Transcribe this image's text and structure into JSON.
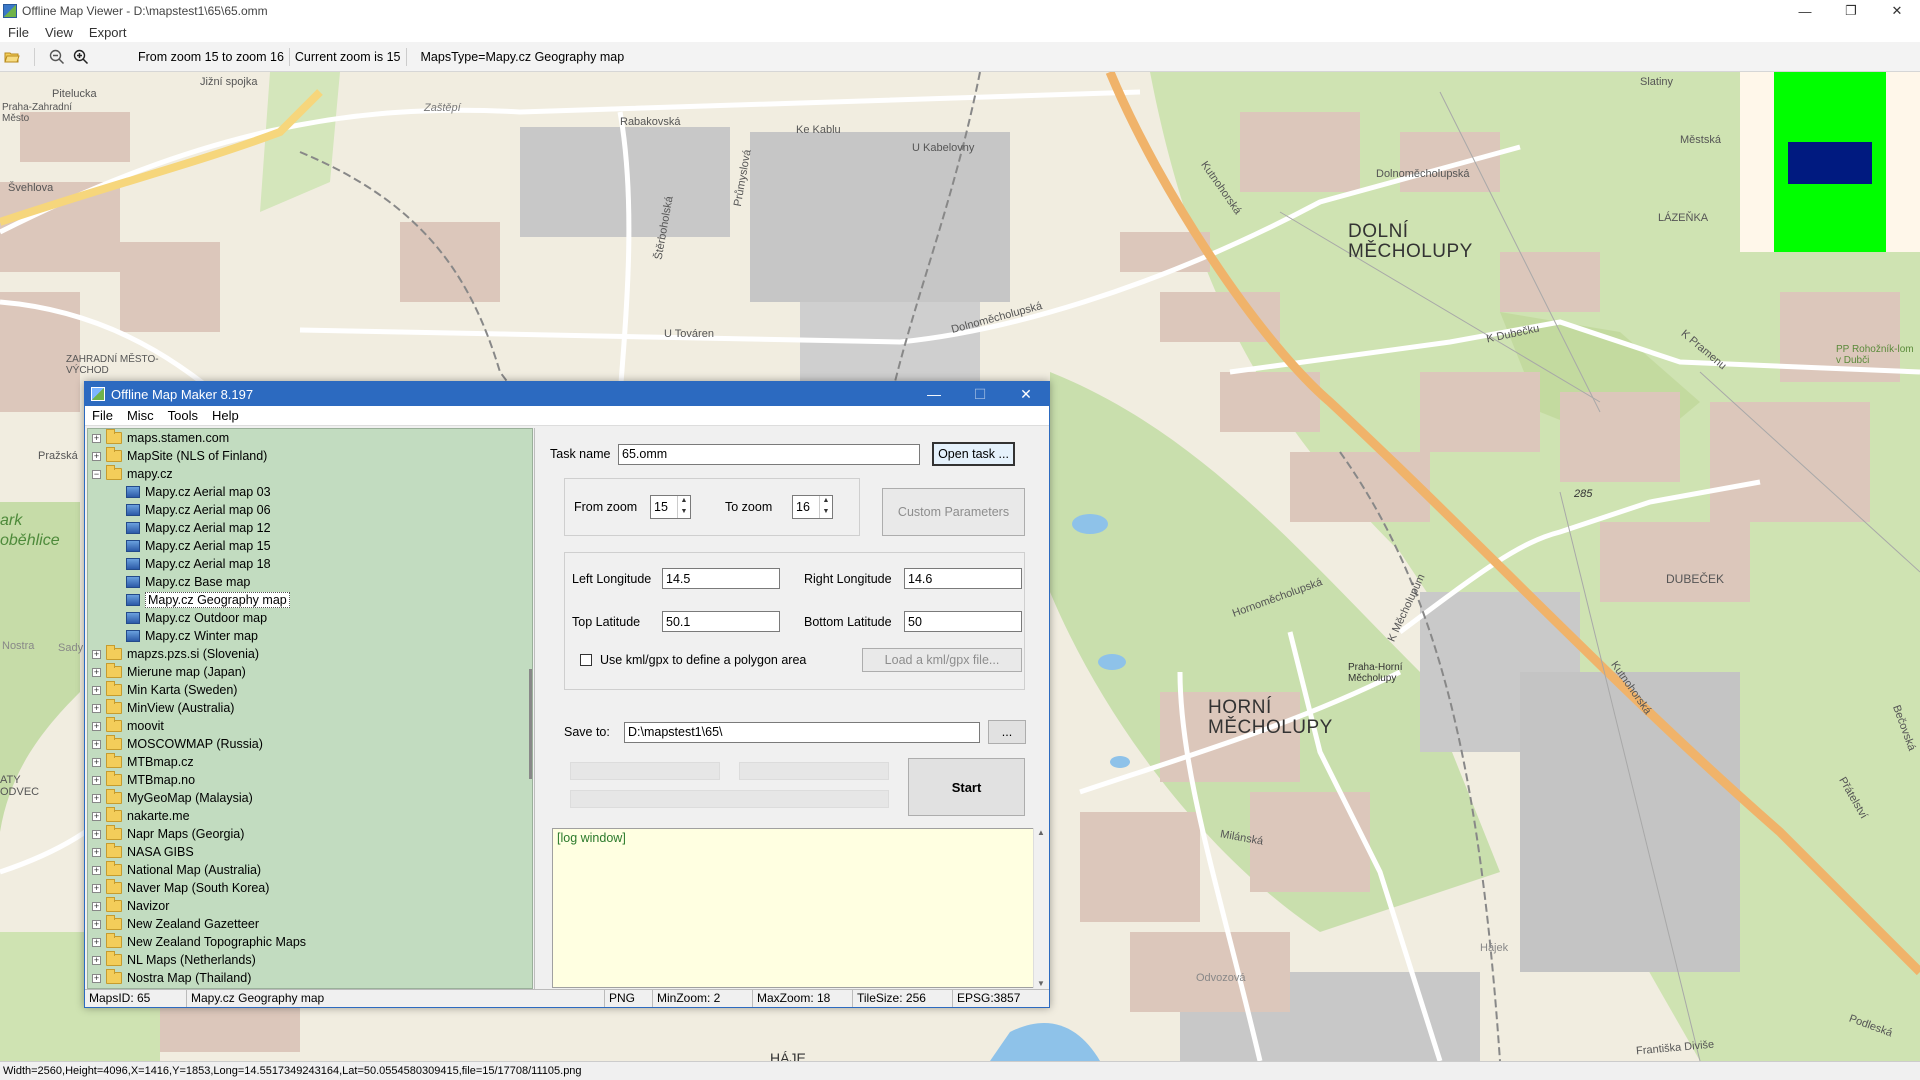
{
  "viewer": {
    "title": "Offline Map Viewer - D:\\mapstest1\\65\\65.omm",
    "menu": [
      "File",
      "View",
      "Export"
    ],
    "toolbar_texts": [
      "From zoom 15 to zoom 16",
      "Current zoom is 15",
      "MapsType=Mapy.cz Geography map"
    ],
    "status": "Width=2560,Height=4096,X=1416,Y=1853,Long=14.5517349243164,Lat=50.0554580309415,file=15/17708/11105.png"
  },
  "map": {
    "labels": [
      "Pitelucka",
      "Jižní spojka",
      "Praha-Zahradní Město",
      "Rabakovská",
      "Ke Kablu",
      "U Kabelovny",
      "Slatiny",
      "Městská",
      "Dolnoměcholupská",
      "LÁZEŇKA",
      "Švehlova",
      "Průmyslová",
      "Štěrboholská",
      "Kutnohorská",
      "U Továren",
      "Dolnoměcholupská",
      "ZAHRADNÍ MĚSTO-VÝCHOD",
      "K Dubečku",
      "K Pramenu",
      "PP Rohožník-lom v Dubči",
      "Pražská",
      "Hornoměcholupská",
      "K Měcholupům",
      "DUBEČEK",
      "Praha-Horní Měcholupy",
      "Milánská",
      "Nostra",
      "Přátelství",
      "Bečovská",
      "Kutnohorská",
      "HÁJE",
      "Františka Diviše",
      "Podleská",
      "285",
      "Zaštěpí",
      "Sady",
      "Hájek",
      "Odvozová",
      "ark",
      "oběhlice",
      "ATY",
      "ODVEC"
    ],
    "districts": [
      "DOLNÍ MĚCHOLUPY",
      "HORNÍ MĚCHOLUPY"
    ]
  },
  "dialog": {
    "title": "Offline Map Maker 8.197",
    "menu": [
      "File",
      "Misc",
      "Tools",
      "Help"
    ],
    "tree": [
      {
        "label": "maps.stamen.com",
        "type": "folder",
        "expanded": false,
        "level": 0
      },
      {
        "label": "MapSite (NLS of Finland)",
        "type": "folder",
        "expanded": false,
        "level": 0
      },
      {
        "label": "mapy.cz",
        "type": "folder",
        "expanded": true,
        "level": 0
      },
      {
        "label": "Mapy.cz Aerial map 03",
        "type": "map",
        "level": 1
      },
      {
        "label": "Mapy.cz Aerial map 06",
        "type": "map",
        "level": 1
      },
      {
        "label": "Mapy.cz Aerial map 12",
        "type": "map",
        "level": 1
      },
      {
        "label": "Mapy.cz Aerial map 15",
        "type": "map",
        "level": 1
      },
      {
        "label": "Mapy.cz Aerial map 18",
        "type": "map",
        "level": 1
      },
      {
        "label": "Mapy.cz Base map",
        "type": "map",
        "level": 1
      },
      {
        "label": "Mapy.cz Geography map",
        "type": "map",
        "level": 1,
        "selected": true
      },
      {
        "label": "Mapy.cz Outdoor map",
        "type": "map",
        "level": 1
      },
      {
        "label": "Mapy.cz Winter map",
        "type": "map",
        "level": 1
      },
      {
        "label": "mapzs.pzs.si (Slovenia)",
        "type": "folder",
        "expanded": false,
        "level": 0
      },
      {
        "label": "Mierune map (Japan)",
        "type": "folder",
        "expanded": false,
        "level": 0
      },
      {
        "label": "Min Karta (Sweden)",
        "type": "folder",
        "expanded": false,
        "level": 0
      },
      {
        "label": "MinView (Australia)",
        "type": "folder",
        "expanded": false,
        "level": 0
      },
      {
        "label": "moovit",
        "type": "folder",
        "expanded": false,
        "level": 0
      },
      {
        "label": "MOSCOWMAP (Russia)",
        "type": "folder",
        "expanded": false,
        "level": 0
      },
      {
        "label": "MTBmap.cz",
        "type": "folder",
        "expanded": false,
        "level": 0
      },
      {
        "label": "MTBmap.no",
        "type": "folder",
        "expanded": false,
        "level": 0
      },
      {
        "label": "MyGeoMap (Malaysia)",
        "type": "folder",
        "expanded": false,
        "level": 0
      },
      {
        "label": "nakarte.me",
        "type": "folder",
        "expanded": false,
        "level": 0
      },
      {
        "label": "Napr Maps (Georgia)",
        "type": "folder",
        "expanded": false,
        "level": 0
      },
      {
        "label": "NASA GIBS",
        "type": "folder",
        "expanded": false,
        "level": 0
      },
      {
        "label": "National Map (Australia)",
        "type": "folder",
        "expanded": false,
        "level": 0
      },
      {
        "label": "Naver Map (South Korea)",
        "type": "folder",
        "expanded": false,
        "level": 0
      },
      {
        "label": "Navizor",
        "type": "folder",
        "expanded": false,
        "level": 0
      },
      {
        "label": "New Zealand Gazetteer",
        "type": "folder",
        "expanded": false,
        "level": 0
      },
      {
        "label": "New Zealand Topographic Maps",
        "type": "folder",
        "expanded": false,
        "level": 0
      },
      {
        "label": "NL Maps (Netherlands)",
        "type": "folder",
        "expanded": false,
        "level": 0
      },
      {
        "label": "Nostra Map (Thailand)",
        "type": "folder",
        "expanded": false,
        "level": 0
      }
    ],
    "task_name_label": "Task name",
    "task_name_value": "65.omm",
    "open_task_label": "Open task ...",
    "from_zoom_label": "From zoom",
    "from_zoom_value": "15",
    "to_zoom_label": "To zoom",
    "to_zoom_value": "16",
    "custom_params_label": "Custom Parameters",
    "left_lon_label": "Left Longitude",
    "left_lon_value": "14.5",
    "right_lon_label": "Right Longitude",
    "right_lon_value": "14.6",
    "top_lat_label": "Top Latitude",
    "top_lat_value": "50.1",
    "bottom_lat_label": "Bottom Latitude",
    "bottom_lat_value": "50",
    "kml_label": "Use kml/gpx to define a polygon area",
    "kml_checked": false,
    "load_kml_label": "Load a kml/gpx file...",
    "save_to_label": "Save to:",
    "save_to_value": "D:\\mapstest1\\65\\",
    "browse_label": "...",
    "start_label": "Start",
    "log_text": "[log window]",
    "status": [
      "MapsID: 65",
      "Mapy.cz Geography map",
      "PNG",
      "MinZoom: 2",
      "MaxZoom: 18",
      "TileSize: 256",
      "EPSG:3857"
    ]
  },
  "colors": {
    "dialog_title": "#2c6ac0",
    "tree_bg": "#c2dcc0",
    "log_bg": "#ffffe1",
    "minimap_green": "#00ff00",
    "minimap_blue": "#001a80"
  }
}
